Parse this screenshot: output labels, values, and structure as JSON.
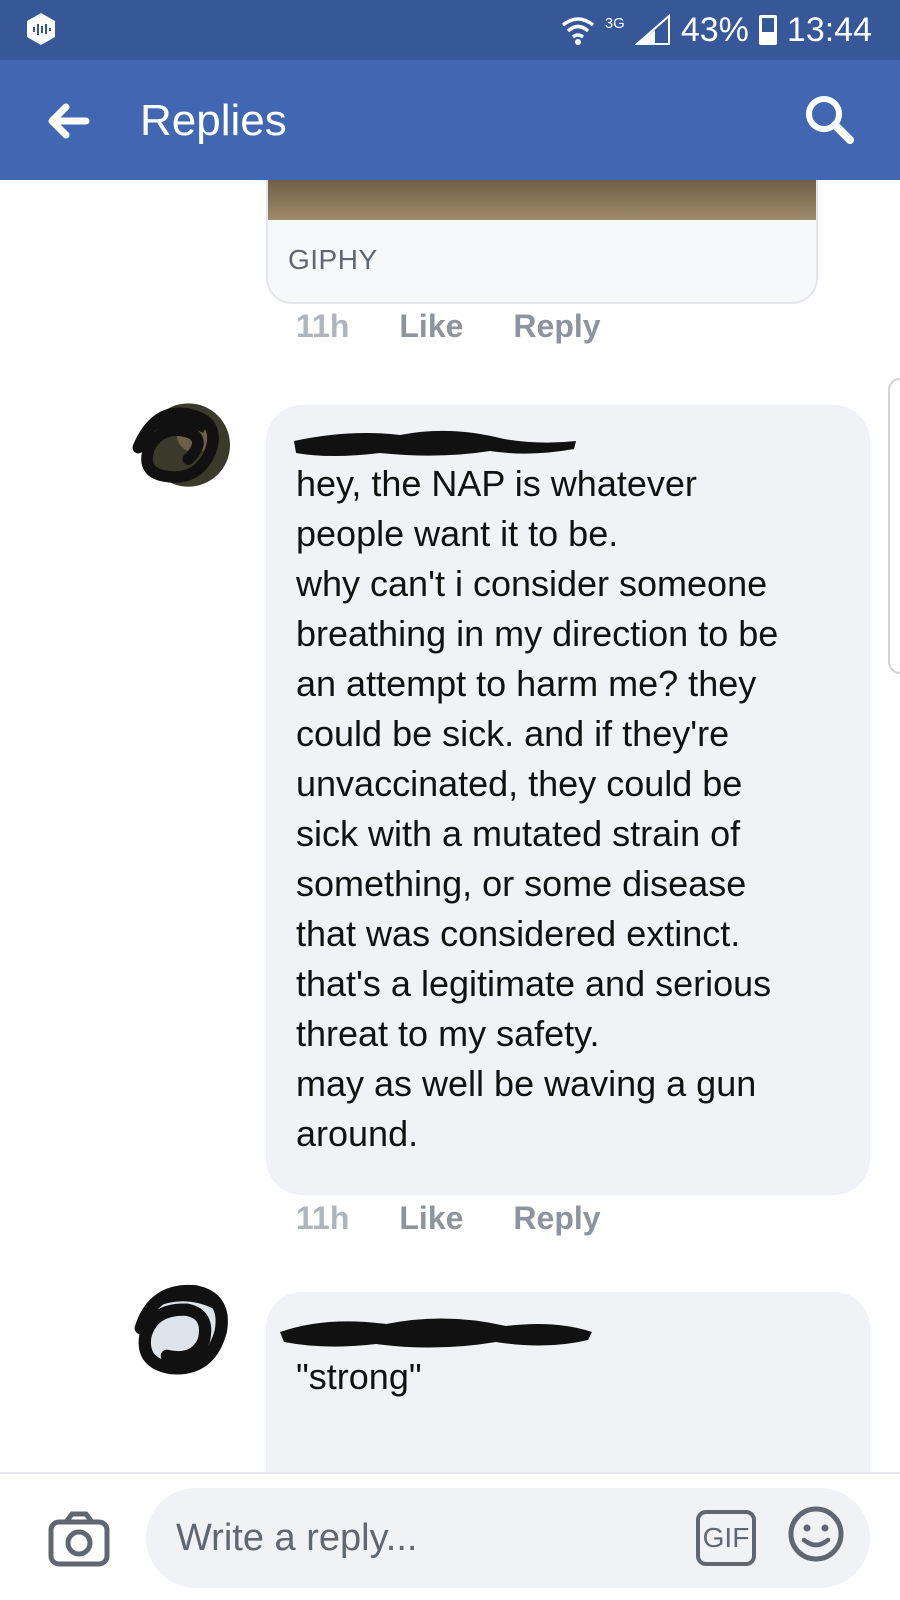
{
  "status_bar": {
    "network": "3G",
    "battery": "43%",
    "time": "13:44",
    "color": "#365899"
  },
  "header": {
    "title": "Replies",
    "color": "#4267b2",
    "back_icon": "arrow-left-icon",
    "search_icon": "search-icon"
  },
  "comments": [
    {
      "attachment_label": "GIPHY",
      "time": "11h",
      "like_label": "Like",
      "reply_label": "Reply"
    },
    {
      "text": "hey, the NAP is whatever\npeople want it to be.\nwhy can't i consider someone\nbreathing in my direction to be\nan attempt to harm me? they\ncould be sick. and if they're\nunvaccinated, they could be\nsick with a mutated strain of\nsomething, or some disease\nthat was considered extinct.\nthat's a legitimate and serious\nthreat to my safety.\nmay as well be waving a gun\naround.",
      "time": "11h",
      "like_label": "Like",
      "reply_label": "Reply"
    },
    {
      "text": "\"strong\""
    }
  ],
  "composer": {
    "placeholder": "Write a reply...",
    "gif_label": "GIF",
    "camera_icon": "camera-icon",
    "emoji_icon": "smiley-icon"
  }
}
